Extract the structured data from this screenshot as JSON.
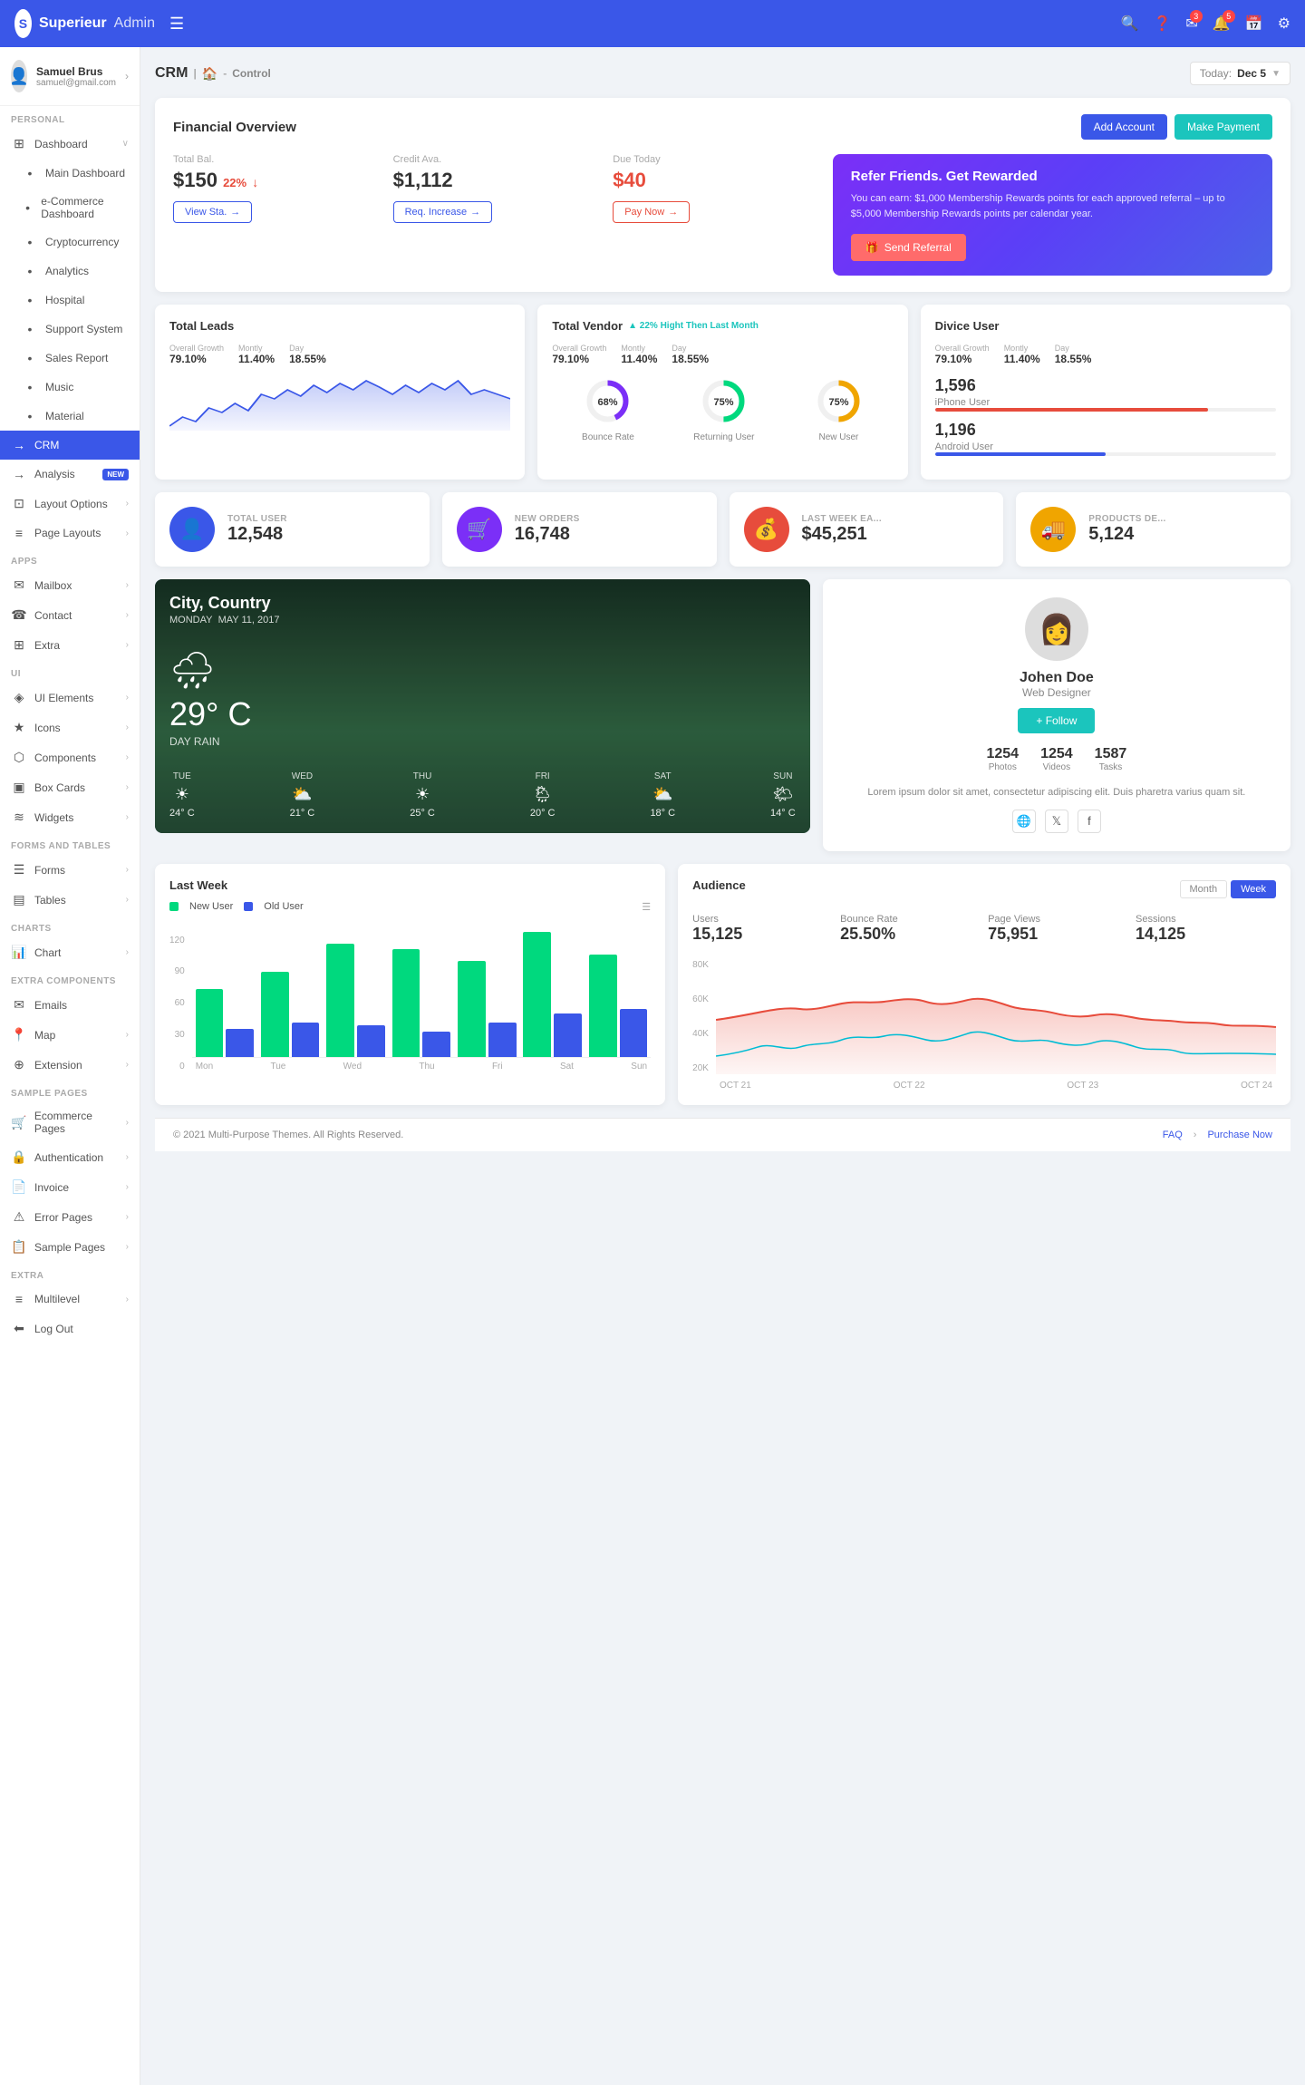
{
  "app": {
    "name": "Superieur",
    "subtitle": "Admin",
    "logo_initial": "S"
  },
  "nav_icons": [
    "search",
    "question",
    "mail",
    "bell",
    "calendar",
    "gear"
  ],
  "user": {
    "name": "Samuel Brus",
    "email": "samuel@gmail.com"
  },
  "sidebar": {
    "sections": [
      {
        "label": "PERSONAL",
        "items": [
          {
            "id": "dashboard",
            "label": "Dashboard",
            "icon": "⊞",
            "has_arrow": true,
            "active": false
          },
          {
            "id": "main-dashboard",
            "label": "Main Dashboard",
            "icon": "•",
            "sub": true,
            "active": false
          },
          {
            "id": "ecommerce-dashboard",
            "label": "e-Commerce Dashboard",
            "icon": "•",
            "sub": true,
            "active": false
          },
          {
            "id": "cryptocurrency",
            "label": "Cryptocurrency",
            "icon": "•",
            "sub": true,
            "active": false
          },
          {
            "id": "analytics",
            "label": "Analytics",
            "icon": "•",
            "sub": true,
            "active": false
          },
          {
            "id": "hospital",
            "label": "Hospital",
            "icon": "•",
            "sub": true,
            "active": false
          },
          {
            "id": "support-system",
            "label": "Support System",
            "icon": "•",
            "sub": true,
            "active": false
          },
          {
            "id": "sales-report",
            "label": "Sales Report",
            "icon": "•",
            "sub": true,
            "active": false
          },
          {
            "id": "music",
            "label": "Music",
            "icon": "•",
            "sub": true,
            "active": false
          },
          {
            "id": "material",
            "label": "Material",
            "icon": "•",
            "sub": true,
            "active": false
          },
          {
            "id": "crm",
            "label": "CRM",
            "icon": "→",
            "active": true
          },
          {
            "id": "analysis",
            "label": "Analysis",
            "icon": "→",
            "badge": "NEW",
            "active": false
          }
        ]
      },
      {
        "label": "",
        "items": [
          {
            "id": "layout-options",
            "label": "Layout Options",
            "icon": "⊡",
            "has_arrow": true,
            "active": false
          },
          {
            "id": "page-layouts",
            "label": "Page Layouts",
            "icon": "≡",
            "has_arrow": true,
            "active": false
          }
        ]
      },
      {
        "label": "APPS",
        "items": [
          {
            "id": "mailbox",
            "label": "Mailbox",
            "icon": "✉",
            "has_arrow": true,
            "active": false
          },
          {
            "id": "contact",
            "label": "Contact",
            "icon": "☎",
            "has_arrow": true,
            "active": false
          },
          {
            "id": "extra",
            "label": "Extra",
            "icon": "⊞",
            "has_arrow": true,
            "active": false
          }
        ]
      },
      {
        "label": "UI",
        "items": [
          {
            "id": "ui-elements",
            "label": "UI Elements",
            "icon": "◈",
            "has_arrow": true,
            "active": false
          },
          {
            "id": "icons",
            "label": "Icons",
            "icon": "★",
            "has_arrow": true,
            "active": false
          },
          {
            "id": "components",
            "label": "Components",
            "icon": "⬡",
            "has_arrow": true,
            "active": false
          },
          {
            "id": "box-cards",
            "label": "Box Cards",
            "icon": "▣",
            "has_arrow": true,
            "active": false
          },
          {
            "id": "widgets",
            "label": "Widgets",
            "icon": "≋",
            "has_arrow": true,
            "active": false
          }
        ]
      },
      {
        "label": "FORMS AND TABLES",
        "items": [
          {
            "id": "forms",
            "label": "Forms",
            "icon": "☰",
            "has_arrow": true,
            "active": false
          },
          {
            "id": "tables",
            "label": "Tables",
            "icon": "▤",
            "has_arrow": true,
            "active": false
          }
        ]
      },
      {
        "label": "CHARTS",
        "items": [
          {
            "id": "chart",
            "label": "Chart",
            "icon": "📊",
            "has_arrow": true,
            "active": false
          }
        ]
      },
      {
        "label": "EXTRA COMPONENTS",
        "items": [
          {
            "id": "emails",
            "label": "Emails",
            "icon": "✉",
            "active": false
          },
          {
            "id": "map",
            "label": "Map",
            "icon": "📍",
            "has_arrow": true,
            "active": false
          },
          {
            "id": "extension",
            "label": "Extension",
            "icon": "⊕",
            "has_arrow": true,
            "active": false
          }
        ]
      },
      {
        "label": "SAMPLE PAGES",
        "items": [
          {
            "id": "ecommerce-pages",
            "label": "Ecommerce Pages",
            "icon": "🛒",
            "has_arrow": true,
            "active": false
          },
          {
            "id": "authentication",
            "label": "Authentication",
            "icon": "🔒",
            "has_arrow": true,
            "active": false
          },
          {
            "id": "invoice",
            "label": "Invoice",
            "icon": "📄",
            "has_arrow": true,
            "active": false
          },
          {
            "id": "error-pages",
            "label": "Error Pages",
            "icon": "⚠",
            "has_arrow": true,
            "active": false
          },
          {
            "id": "sample-pages",
            "label": "Sample Pages",
            "icon": "📋",
            "has_arrow": true,
            "active": false
          }
        ]
      },
      {
        "label": "EXTRA",
        "items": [
          {
            "id": "multilevel",
            "label": "Multilevel",
            "icon": "≡",
            "has_arrow": true,
            "active": false
          },
          {
            "id": "log-out",
            "label": "Log Out",
            "icon": "⬅",
            "active": false
          }
        ]
      }
    ]
  },
  "breadcrumb": {
    "page": "CRM",
    "home_icon": "🏠",
    "separator": "-",
    "current": "Control",
    "date_label": "Today:",
    "date_value": "Dec 5"
  },
  "financial": {
    "title": "Financial Overview",
    "btn_add": "Add Account",
    "btn_pay": "Make Payment",
    "total_bal_label": "Total Bal.",
    "total_bal_value": "$150",
    "total_bal_percent": "22%",
    "credit_label": "Credit Ava.",
    "credit_value": "$1,112",
    "due_label": "Due Today",
    "due_value": "$40",
    "btn_view": "View Sta.",
    "btn_req": "Req. Increase",
    "btn_pay_now": "Pay Now",
    "referral_title": "Refer Friends. Get Rewarded",
    "referral_text": "You can earn: $1,000 Membership Rewards points for each approved referral – up to $5,000 Membership Rewards points per calendar year.",
    "btn_referral": "Send Referral"
  },
  "metrics": {
    "total_leads": {
      "title": "Total Leads",
      "overall_growth": "79.10%",
      "monthly": "11.40%",
      "day": "18.55%"
    },
    "total_vendor": {
      "title": "Total Vendor",
      "tag": "▲ 22% Hight Then Last Month",
      "overall_growth": "79.10%",
      "monthly": "11.40%",
      "day": "18.55%",
      "donuts": [
        {
          "label": "Bounce Rate",
          "percent": 68,
          "color": "#7b2ff7"
        },
        {
          "label": "Returning User",
          "percent": 75,
          "color": "#00d97e"
        },
        {
          "label": "New User",
          "percent": 75,
          "color": "#f0a500"
        }
      ]
    },
    "device_user": {
      "title": "Divice User",
      "overall_growth": "79.10%",
      "monthly": "11.40%",
      "day": "18.55%",
      "iphone_count": "1,596",
      "iphone_label": "iPhone User",
      "iphone_percent": 80,
      "android_count": "1,196",
      "android_label": "Android User",
      "android_percent": 50
    }
  },
  "stats": [
    {
      "id": "total-user",
      "label": "TOTAL USER",
      "value": "12,548",
      "icon": "👤",
      "color": "blue"
    },
    {
      "id": "new-orders",
      "label": "NEW ORDERS",
      "value": "16,748",
      "icon": "🛒",
      "color": "purple"
    },
    {
      "id": "last-week",
      "label": "LAST WEEK EA...",
      "value": "$45,251",
      "icon": "💰",
      "color": "red"
    },
    {
      "id": "products",
      "label": "PRODUCTS DE...",
      "value": "5,124",
      "icon": "🚚",
      "color": "yellow"
    }
  ],
  "weather": {
    "location": "City, Country",
    "day": "MONDAY",
    "date": "May 11, 2017",
    "icon": "🌧",
    "temp": "29° C",
    "desc": "DAY RAIN",
    "forecast": [
      {
        "day": "TUE",
        "icon": "☀",
        "temp": "24° C"
      },
      {
        "day": "WED",
        "icon": "⛅",
        "temp": "21° C"
      },
      {
        "day": "THU",
        "icon": "☀",
        "temp": "25° C"
      },
      {
        "day": "FRI",
        "icon": "🌦",
        "temp": "20° C"
      },
      {
        "day": "SAT",
        "icon": "⛅",
        "temp": "18° C"
      },
      {
        "day": "SUN",
        "icon": "🌤",
        "temp": "14° C"
      }
    ]
  },
  "profile": {
    "name": "Johen Doe",
    "role": "Web Designer",
    "btn_follow": "+ Follow",
    "photos": "1254",
    "videos": "1254",
    "tasks": "1587",
    "bio": "Lorem ipsum dolor sit amet, consectetur adipiscing elit. Duis pharetra varius quam sit."
  },
  "last_week_chart": {
    "title": "Last Week",
    "legend_new": "New User",
    "legend_old": "Old User",
    "bars": [
      {
        "day": "Mon",
        "new": 60,
        "old": 25
      },
      {
        "day": "Tue",
        "new": 75,
        "old": 30
      },
      {
        "day": "Wed",
        "new": 100,
        "old": 28
      },
      {
        "day": "Thu",
        "new": 95,
        "old": 22
      },
      {
        "day": "Fri",
        "new": 85,
        "old": 30
      },
      {
        "day": "Sat",
        "new": 110,
        "old": 38
      },
      {
        "day": "Sun",
        "new": 90,
        "old": 42
      }
    ],
    "y_labels": [
      "120",
      "90",
      "60",
      "30",
      "0"
    ]
  },
  "audience": {
    "title": "Audience",
    "toggle_month": "Month",
    "toggle_week": "Week",
    "metrics": [
      {
        "label": "Users",
        "value": "15,125"
      },
      {
        "label": "Bounce Rate",
        "value": "25.50%"
      },
      {
        "label": "Page Views",
        "value": "75,951"
      },
      {
        "label": "Sessions",
        "value": "14,125"
      }
    ],
    "chart_labels": [
      "OCT 21",
      "OCT 22",
      "OCT 23",
      "OCT 24"
    ],
    "y_labels": [
      "80K",
      "60K",
      "40K",
      "20K"
    ]
  },
  "footer": {
    "copyright": "© 2021 Multi-Purpose Themes. All Rights Reserved.",
    "links": [
      "FAQ",
      "Purchase Now"
    ]
  }
}
